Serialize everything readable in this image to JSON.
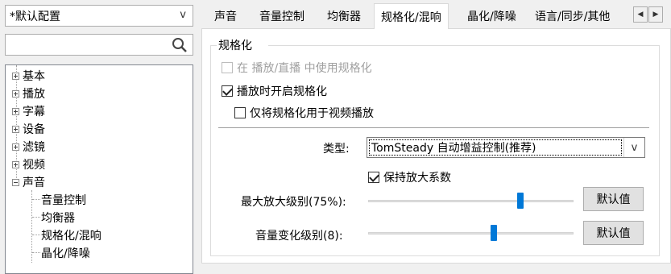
{
  "profile": {
    "selected": "*默认配置"
  },
  "search": {
    "value": "",
    "placeholder": ""
  },
  "tree": {
    "items": [
      {
        "label": "基本",
        "expanded": false
      },
      {
        "label": "播放",
        "expanded": false
      },
      {
        "label": "字幕",
        "expanded": false
      },
      {
        "label": "设备",
        "expanded": false
      },
      {
        "label": "滤镜",
        "expanded": false
      },
      {
        "label": "视频",
        "expanded": false
      },
      {
        "label": "声音",
        "expanded": true
      }
    ],
    "children": [
      "音量控制",
      "均衡器",
      "规格化/混响",
      "晶化/降噪"
    ]
  },
  "tabs": {
    "items": [
      "声音",
      "音量控制",
      "均衡器",
      "规格化/混响",
      "晶化/降噪",
      "语言/同步/其他"
    ],
    "active_index": 3
  },
  "normalization": {
    "group_title": "规格化",
    "use_in_streams": {
      "label": "在 播放/直播 中使用规格化",
      "checked": false,
      "enabled": false
    },
    "enable_on_play": {
      "label": "播放时开启规格化",
      "checked": true
    },
    "video_only": {
      "label": "仅将规格化用于视频播放",
      "checked": false
    },
    "type_label": "类型:",
    "type_value": "TomSteady 自动增益控制(推荐)",
    "keep_factor": {
      "label": "保持放大系数",
      "checked": true
    },
    "max_amp": {
      "label": "最大放大级别(75%):",
      "percent": 75
    },
    "volume_change": {
      "label": "音量变化级别(8):",
      "level": 8
    },
    "default_button": "默认值"
  },
  "colors": {
    "accent": "#0078d7",
    "panel_bg": "#ffffff",
    "window_bg": "#f0f0f0"
  }
}
